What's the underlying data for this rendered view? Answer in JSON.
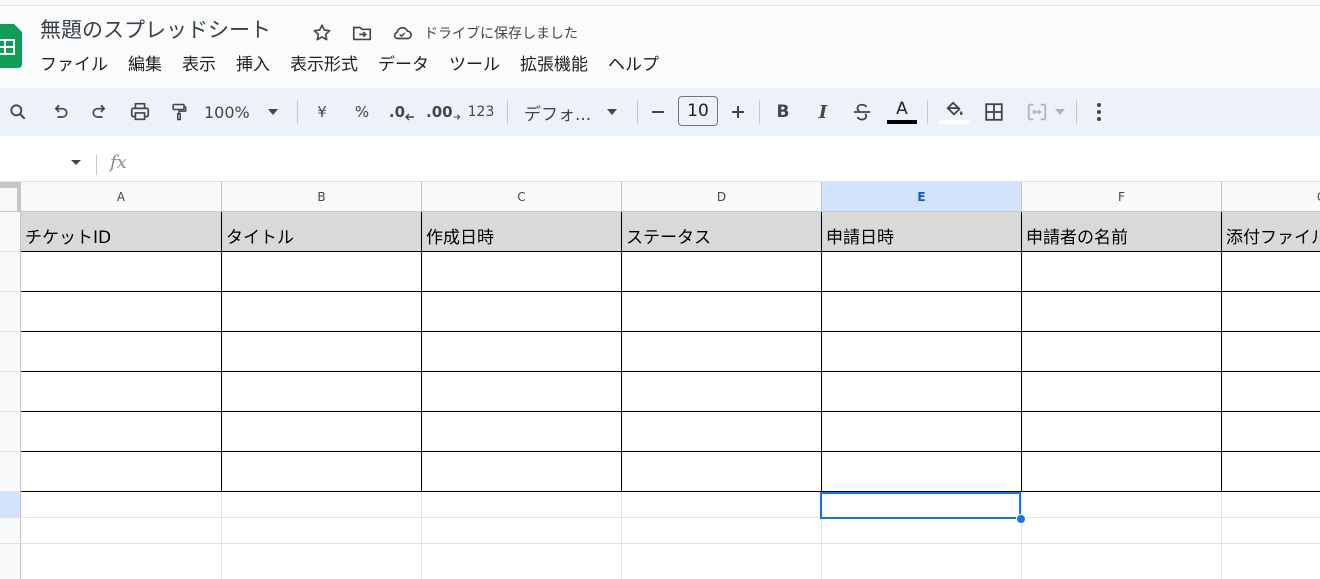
{
  "app": {
    "doc_title": "無題のスプレッドシート",
    "save_status": "ドライブに保存しました"
  },
  "menu": [
    "ファイル",
    "編集",
    "表示",
    "挿入",
    "表示形式",
    "データ",
    "ツール",
    "拡張機能",
    "ヘルプ"
  ],
  "toolbar": {
    "zoom": "100%",
    "currency": "¥",
    "percent": "%",
    "decrease_decimal": ".0",
    "increase_decimal": ".00",
    "number_format": "123",
    "font": "デフォ...",
    "font_size": "10",
    "bold": "B",
    "italic": "I",
    "text_color_letter": "A"
  },
  "formula_bar": {
    "fx": "fx"
  },
  "grid": {
    "columns": [
      "A",
      "B",
      "C",
      "D",
      "E",
      "F",
      "G"
    ],
    "selected_column": "E",
    "header_row": [
      "チケットID",
      "タイトル",
      "作成日時",
      "ステータス",
      "申請日時",
      "申請者の名前",
      "添付ファイル"
    ],
    "selected_cell": "E8"
  },
  "colors": {
    "accent": "#1a73e8",
    "toolbar_bg": "#edf2fa",
    "header_fill": "#d9d9d9",
    "selected_header": "#d3e3fd"
  }
}
